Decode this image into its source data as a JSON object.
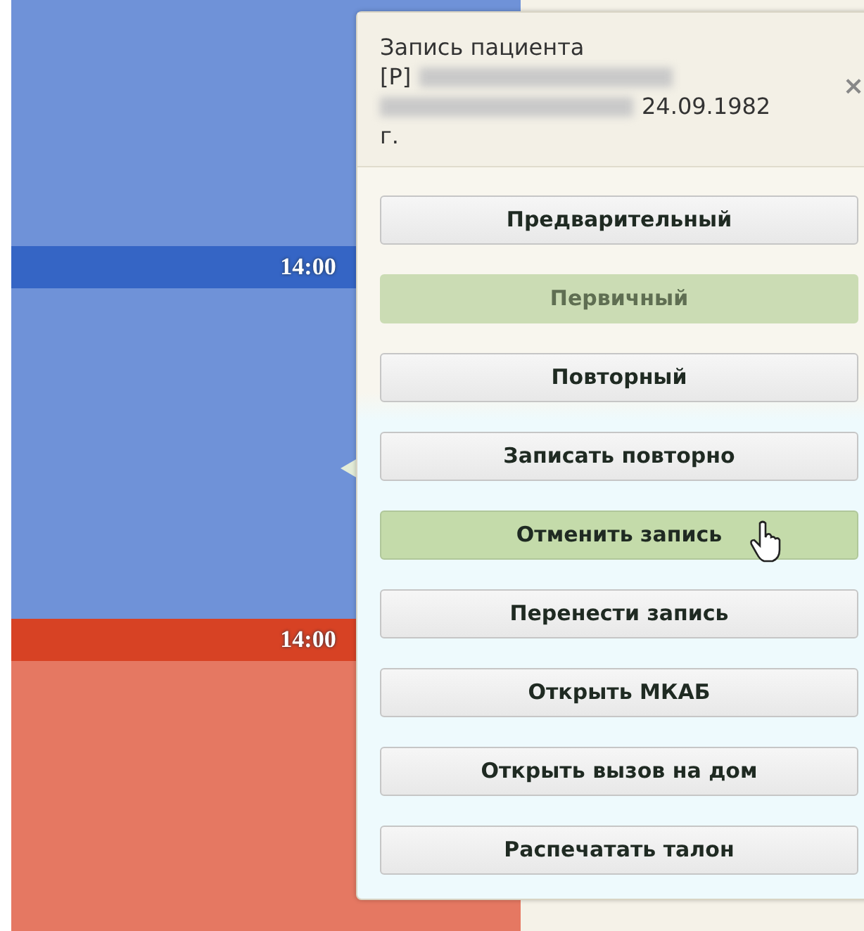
{
  "calendar": {
    "slots": [
      {
        "color": "#6f92d8"
      },
      {
        "time": "14:00",
        "color": "#6f92d8"
      },
      {
        "time": "14:00",
        "color": "#e57862"
      }
    ]
  },
  "popup": {
    "header": {
      "lines": [
        [
          {
            "kind": "text",
            "text": "Запись пациента"
          }
        ],
        [
          {
            "kind": "text",
            "text": "[Р]"
          },
          {
            "kind": "redacted"
          }
        ],
        [
          {
            "kind": "redacted"
          },
          {
            "kind": "text",
            "text": "24.09.1982"
          }
        ],
        [
          {
            "kind": "text",
            "text": "г."
          }
        ]
      ],
      "close": "×"
    },
    "buttons": [
      {
        "label": "Предварительный",
        "disabled": false,
        "hovered": false
      },
      {
        "label": "Первичный",
        "disabled": true,
        "hovered": false
      },
      {
        "label": "Повторный",
        "disabled": false,
        "hovered": false
      },
      {
        "label": "Записать повторно",
        "disabled": false,
        "hovered": false
      },
      {
        "label": "Отменить запись",
        "disabled": false,
        "hovered": true
      },
      {
        "label": "Перенести запись",
        "disabled": false,
        "hovered": false
      },
      {
        "label": "Открыть МКАБ",
        "disabled": false,
        "hovered": false
      },
      {
        "label": "Открыть вызов на дом",
        "disabled": false,
        "hovered": false
      },
      {
        "label": "Распечатать талон",
        "disabled": false,
        "hovered": false
      }
    ]
  }
}
